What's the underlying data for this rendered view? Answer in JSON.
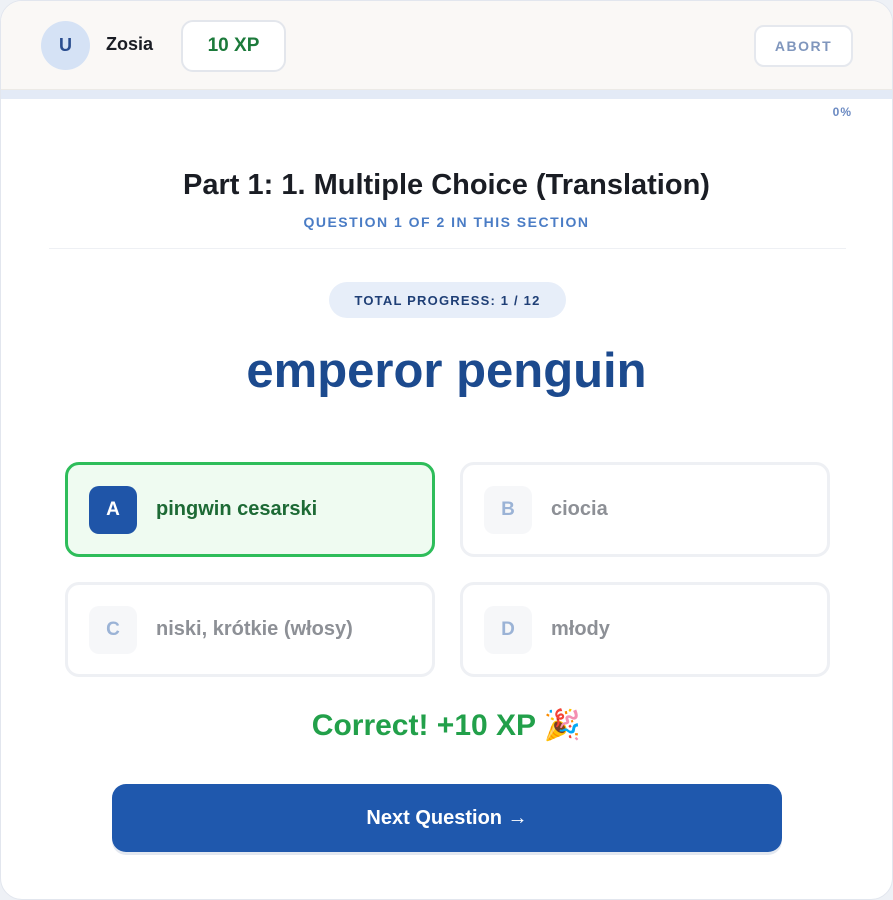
{
  "header": {
    "avatar_initial": "U",
    "username": "Zosia",
    "xp": "10 XP",
    "abort_label": "ABORT"
  },
  "progress": {
    "percent_label": "0%",
    "fraction": 0
  },
  "section": {
    "title": "Part 1: 1. Multiple Choice (Translation)",
    "subtitle": "QUESTION 1 OF 2 IN THIS SECTION"
  },
  "total_progress": "TOTAL PROGRESS: 1 / 12",
  "prompt": "emperor penguin",
  "options": [
    {
      "letter": "A",
      "text": "pingwin cesarski",
      "state": "correct"
    },
    {
      "letter": "B",
      "text": "ciocia",
      "state": "dimmed"
    },
    {
      "letter": "C",
      "text": "niski, krótkie (włosy)",
      "state": "dimmed"
    },
    {
      "letter": "D",
      "text": "młody",
      "state": "dimmed"
    }
  ],
  "feedback": "Correct! +10 XP 🎉",
  "next_button": "Next Question →",
  "colors": {
    "primary": "#1f58ad",
    "correct": "#2ebd5a",
    "xp_green": "#1c7a3b"
  }
}
